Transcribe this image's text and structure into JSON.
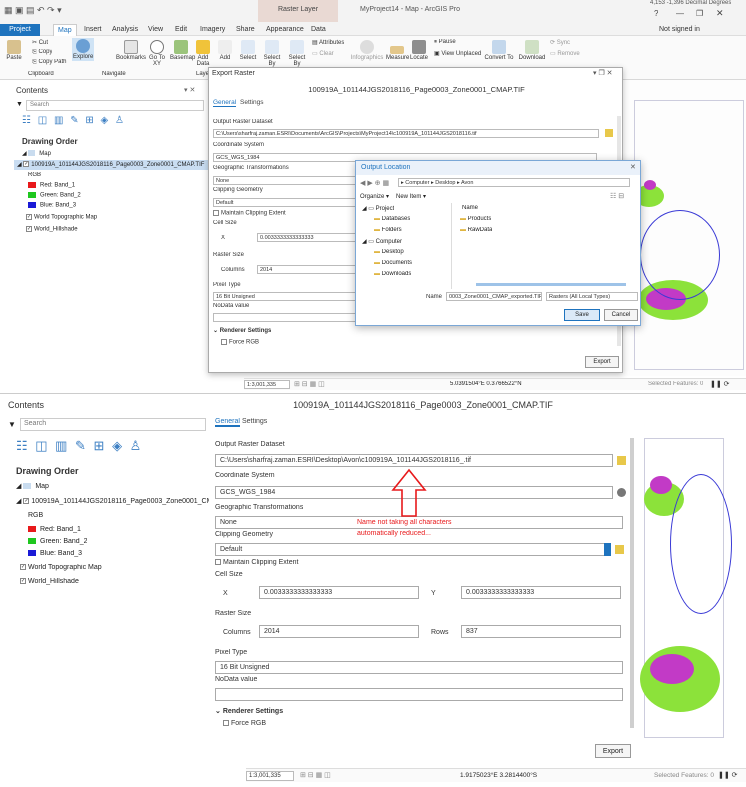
{
  "app": {
    "title": "MyProject14 - Map - ArcGIS Pro",
    "raster_layer_context": "Raster Layer",
    "sign_in": "Not signed in",
    "help": "?",
    "coords_top": "4,153  -1,396 Decimal Degrees",
    "tabs": [
      "Project",
      "Map",
      "Insert",
      "Analysis",
      "View",
      "Edit",
      "Imagery",
      "Share",
      "Appearance",
      "Data"
    ]
  },
  "ribbon": {
    "clipboard": {
      "paste": "Paste",
      "cut": "Cut",
      "copy": "Copy",
      "copy_path": "Copy Path",
      "group": "Clipboard"
    },
    "navigate": {
      "explore": "Explore",
      "bookmarks": "Bookmarks",
      "go_to_xy": "Go To XY",
      "group": "Navigate"
    },
    "layer": {
      "basemap": "Basemap",
      "add_data": "Add Data",
      "group": "Layer"
    },
    "selection": {
      "add": "Add",
      "select": "Select",
      "select_by_attr": "Select By",
      "select_by_loc": "Select By",
      "attributes": "Attributes",
      "clear": "Clear"
    },
    "inquiry": {
      "infographics": "Infographics",
      "measure": "Measure",
      "locate": "Locate"
    },
    "labeling": {
      "pause": "Pause",
      "view_unplaced": "View Unplaced"
    },
    "convert": {
      "convert_to": "Convert To"
    },
    "offline": {
      "download": "Download",
      "sync": "Sync",
      "remove": "Remove"
    }
  },
  "contents": {
    "title": "Contents",
    "search_placeholder": "Search",
    "drawing_order": "Drawing Order",
    "map_label": "Map",
    "layer_name": "100919A_101144JGS2018116_Page0003_Zone0001_CMAP.TIF",
    "rgb": "RGB",
    "bands": [
      {
        "label": "Red:  Band_1",
        "color": "#e8191b"
      },
      {
        "label": "Green: Band_2",
        "color": "#1fc71f"
      },
      {
        "label": "Blue:  Band_3",
        "color": "#1a1ad6"
      }
    ],
    "basemaps": [
      "World Topographic Map",
      "World_Hillshade"
    ]
  },
  "export_top": {
    "window_title": "Export Raster",
    "heading": "100919A_101144JGS2018116_Page0003_Zone0001_CMAP.TIF",
    "tabs": [
      "General",
      "Settings"
    ],
    "output_label": "Output Raster Dataset",
    "output_value": "C:\\Users\\sharfraj.zaman.ESRI\\Documents\\ArcGIS\\Projects\\MyProject14\\c100919A_101144JGS2018116.tif",
    "cs_label": "Coordinate System",
    "cs_value": "GCS_WGS_1984",
    "geo_label": "Geographic Transformations",
    "geo_value": "None",
    "clip_label": "Clipping Geometry",
    "clip_value": "Default",
    "maintain": "Maintain Clipping Extent",
    "cell_label": "Cell Size",
    "x_label": "X",
    "x_value": "0.0033333333333333",
    "raster_size_label": "Raster Size",
    "columns_label": "Columns",
    "columns_value": "2014",
    "pixel_label": "Pixel Type",
    "pixel_value": "16 Bit Unsigned",
    "nodata_label": "NoData value",
    "renderer": "Renderer Settings",
    "force_rgb": "Force RGB",
    "export_btn": "Export"
  },
  "output_location": {
    "title": "Output Location",
    "path": [
      "Computer",
      "Desktop",
      "Avon"
    ],
    "organize": "Organize",
    "new_item": "New Item",
    "tree": [
      "Project",
      "Databases",
      "Folders",
      "Computer",
      "Desktop",
      "Documents",
      "Downloads"
    ],
    "col_name": "Name",
    "files": [
      "Products",
      "RawData"
    ],
    "name_label": "Name",
    "name_value": "0003_Zone0001_CMAP_exported.TIF",
    "type_value": "Rasters (All Local Types)",
    "save": "Save",
    "cancel": "Cancel"
  },
  "status_top": {
    "scale": "1:3,001,335",
    "coords": "5.0391504°E 0.3766522°N",
    "selected": "Selected Features: 0"
  },
  "export_bottom": {
    "heading": "100919A_101144JGS2018116_Page0003_Zone0001_CMAP.TIF",
    "tabs": [
      "General",
      "Settings"
    ],
    "output_label": "Output Raster Dataset",
    "output_value": "C:\\Users\\sharfraj.zaman.ESRI\\Desktop\\Avon\\c100919A_101144JGS2018116_.tif",
    "cs_label": "Coordinate System",
    "cs_value": "GCS_WGS_1984",
    "geo_label": "Geographic Transformations",
    "geo_value": "None",
    "clip_label": "Clipping Geometry",
    "clip_value": "Default",
    "maintain": "Maintain Clipping Extent",
    "cell_label": "Cell Size",
    "x_label": "X",
    "x_value": "0.0033333333333333",
    "y_label": "Y",
    "y_value": "0.0033333333333333",
    "raster_size_label": "Raster Size",
    "columns_label": "Columns",
    "columns_value": "2014",
    "rows_label": "Rows",
    "rows_value": "837",
    "pixel_label": "Pixel Type",
    "pixel_value": "16 Bit Unsigned",
    "nodata_label": "NoData value",
    "renderer": "Renderer Settings",
    "force_rgb": "Force RGB",
    "export_btn": "Export",
    "annotation_line1": "Name not taking all characters",
    "annotation_line2": "automatically reduced...",
    "annotation_color": "#e8191b"
  },
  "status_bottom": {
    "scale": "1:3,001,335",
    "coords": "1.9175023°E 3.2814400°S",
    "selected": "Selected Features: 0"
  },
  "colors": {
    "accent": "#1e73be",
    "map_green": "#8ce23a",
    "map_magenta": "#c23ac6"
  }
}
